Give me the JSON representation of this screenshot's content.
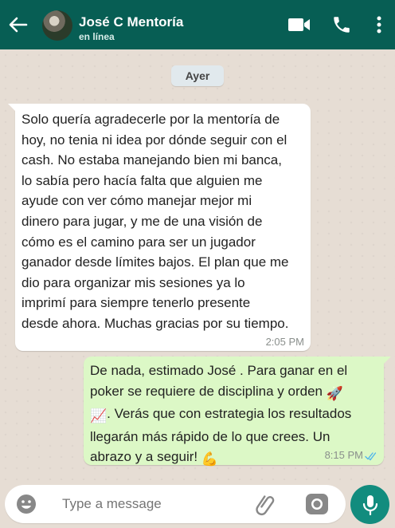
{
  "header": {
    "contact_name": "José C Mentoría",
    "status": "en línea",
    "icons": [
      "back-arrow-icon",
      "video-call-icon",
      "phone-icon",
      "more-options-icon"
    ],
    "background_color": "#075e54"
  },
  "chat": {
    "date_separator": "Ayer",
    "messages": [
      {
        "direction": "incoming",
        "text": "Solo quería agradecerle por la mentoría de\nhoy, no tenia ni idea por dónde seguir con el\ncash. No estaba manejando bien mi banca,\nlo sabía pero hacía falta que alguien me\nayude con ver cómo manejar mejor mi\ndinero para jugar, y me de una visión de\ncómo es el camino para ser un jugador\nganador desde límites bajos. El plan que me\ndio para organizar mis sesiones ya lo\nimprimí para siempre tenerlo presente\ndesde ahora. Muchas gracias por su tiempo.",
        "time": "2:05 PM"
      },
      {
        "direction": "outgoing",
        "text_line1": "De nada, estimado José . Para ganar en el",
        "text_line2": "poker se requiere de disciplina y orden",
        "emoji_rocket": "🚀",
        "emoji_chart": "📈",
        "text_line3": ". Verás que con estrategia los resultados",
        "text_line4": "llegarán más rápido de lo que crees. Un",
        "text_line5": "abrazo y a seguir!",
        "emoji_muscle": "💪",
        "time": "8:15 PM",
        "read_status": "double-check-read"
      }
    ]
  },
  "composer": {
    "placeholder": "Type a message",
    "icons": [
      "emoji-icon",
      "attach-icon",
      "camera-icon",
      "microphone-icon"
    ]
  },
  "colors": {
    "incoming_bubble": "#ffffff",
    "outgoing_bubble": "#dcf8c6",
    "read_ticks": "#4fb6ec",
    "mic_button": "#128c7e"
  }
}
